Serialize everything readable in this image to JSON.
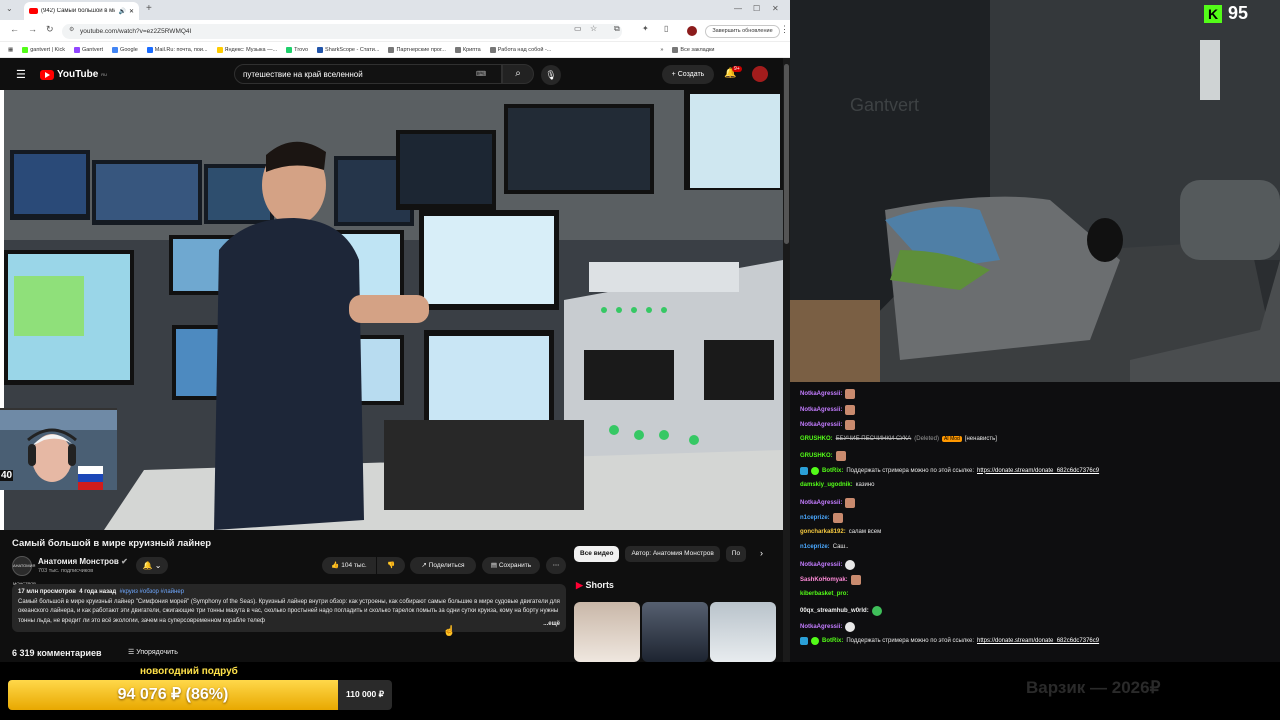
{
  "browser": {
    "tab_title": "(942) Самый большой в ми",
    "url": "youtube.com/watch?v=ez2Z5RWMQ4I",
    "update_button": "Завершить обновление",
    "bookmarks": [
      "gantvert | Kick",
      "Gantvert",
      "Google",
      "Mail.Ru: почта, пои...",
      "Яндекс: Музыка —...",
      "Trovo",
      "SharkScope - Стати...",
      "Партнерские прог...",
      "Крипта",
      "Работа над собой -..."
    ],
    "all_bookmarks": "Все закладки"
  },
  "youtube": {
    "logo": "YouTube",
    "logo_region": "RU",
    "search_value": "путешествие на край вселенной",
    "create_label": "Создать",
    "notif_badge": "9+",
    "video_title": "Самый большой в мире круизный лайнер",
    "channel_name": "Анатомия Монстров",
    "channel_icon_text": "АНАТОМИЯ МОНСТРОВ",
    "subscribers": "703 тыс. подписчиков",
    "likes": "104 тыс.",
    "share_label": "Поделиться",
    "save_label": "Сохранить",
    "views": "17 млн просмотров",
    "age": "4 года назад",
    "tags": "#круиз #обзор #лайнер",
    "description": "Самый большой в мире круизный лайнер \"Симфония морей\" (Symphony of the Seas). Круизный лайнер внутри обзор: как устроены, как собирают самые большие в мире судовые двигатели для океанского лайнера, и как работают эти двигатели, сжигающие три тонны мазута в час, сколько простыней надо погладить и сколько тарелок помыть за одни сутки круиза, кому на борту нужны тонны льда, не вредит ли это всё экологии, зачем на суперсовременном корабле телеф",
    "more_label": "...ещё",
    "comments_count": "6 319 комментариев",
    "sort_label": "Упорядочить",
    "chips": [
      "Все видео",
      "Автор: Анатомия Монстров",
      "По"
    ],
    "shorts_title": "Shorts"
  },
  "stream": {
    "viewer_count": "95",
    "kick_logo": "K",
    "goal_title": "новогодний подруб",
    "goal_amount": "94 076 ₽ (86%)",
    "goal_progress": 0.86,
    "goal_target": "110 000 ₽",
    "watermark": "Варзик — 2026₽",
    "room_wall_text": "Gantvert"
  },
  "chat": [
    {
      "user": "NotkaAgressii:",
      "color": "#c37cff",
      "text": "",
      "emote": "face"
    },
    {
      "user": "NotkaAgressii:",
      "color": "#c37cff",
      "text": "",
      "emote": "face"
    },
    {
      "user": "NotkaAgressii:",
      "color": "#c37cff",
      "text": "",
      "emote": "face"
    },
    {
      "user": "GRUSHKO:",
      "color": "#53fc18",
      "text": "ЕБУЧИЕ ПЕСЧИНКИ СУКА",
      "deleted": "(Deleted)",
      "mod": "AI Mod",
      "extra": "[ненависть]"
    },
    {
      "user": "GRUSHKO:",
      "color": "#53fc18",
      "text": "",
      "emote": "face"
    },
    {
      "user": "BotRix:",
      "color": "#53fc18",
      "text": "Поддержать стримера можно по этой ссылке:",
      "link": "https://donate.stream/donate_682c6dc7376c9",
      "badges": true
    },
    {
      "user": "damskiy_ugodnik:",
      "color": "#53fc18",
      "text": "казино"
    },
    {
      "user": "NotkaAgressii:",
      "color": "#c37cff",
      "text": "",
      "emote": "face"
    },
    {
      "user": "n1ceprize:",
      "color": "#4aa8ff",
      "text": "",
      "emote": "face"
    },
    {
      "user": "goncharka8192:",
      "color": "#f3c73f",
      "text": "салам всем"
    },
    {
      "user": "n1ceprize:",
      "color": "#4aa8ff",
      "text": "Саш.."
    },
    {
      "user": "NotkaAgressii:",
      "color": "#c37cff",
      "text": "",
      "emote": "white"
    },
    {
      "user": "SashKoHomyak:",
      "color": "#ff8ad8",
      "text": "",
      "emote": "face"
    },
    {
      "user": "kiberbasket_pro:",
      "color": "#53fc18",
      "text": ""
    },
    {
      "user": "00qx_streamhub_w0rld:",
      "color": "#f1f1f1",
      "text": "",
      "emote": "green"
    },
    {
      "user": "NotkaAgressii:",
      "color": "#c37cff",
      "text": "",
      "emote": "white"
    },
    {
      "user": "BotRix:",
      "color": "#53fc18",
      "text": "Поддержать стримера можно по этой ссылке:",
      "link": "https://donate.stream/donate_682c6dc7376c9",
      "badges": true
    }
  ],
  "colors": {
    "accent_kick": "#53fc18",
    "yt_red": "#ff0000",
    "goal_yellow": "#ffd84a"
  }
}
